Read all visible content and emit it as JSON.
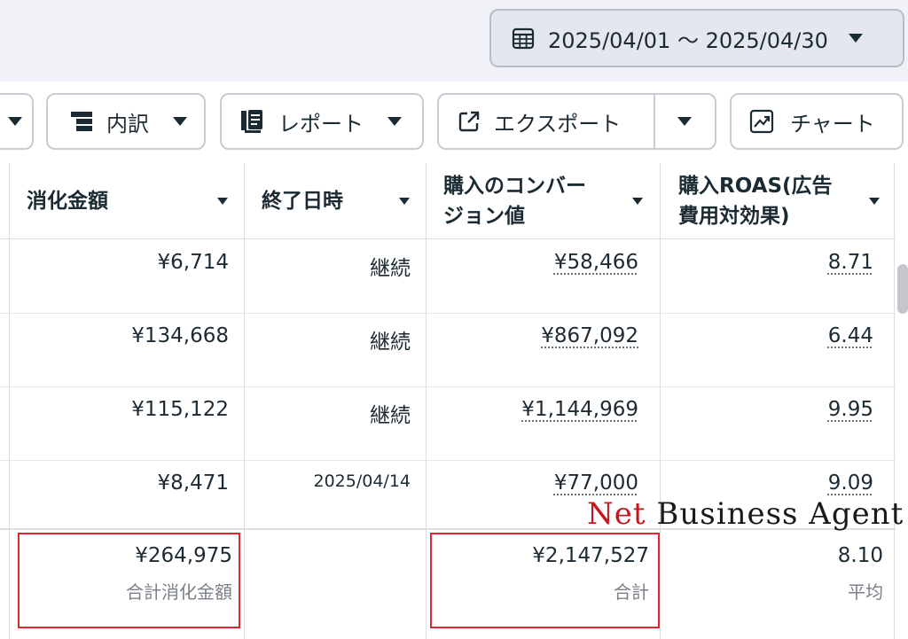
{
  "date_range": {
    "label": "2025/04/01 〜 2025/04/30",
    "icon": "calendar-icon"
  },
  "toolbar": {
    "breakdown_label": "内訳",
    "report_label": "レポート",
    "export_label": "エクスポート",
    "chart_label": "チャート"
  },
  "columns": {
    "spend": "消化金額",
    "end_date": "終了日時",
    "purchase_value_line1": "購入のコンバー",
    "purchase_value_line2": "ジョン値",
    "roas_line1": "購入ROAS(広告",
    "roas_line2": "費用対効果)"
  },
  "rows": [
    {
      "spend": "¥6,714",
      "end": "継続",
      "value": "¥58,466",
      "roas": "8.71"
    },
    {
      "spend": "¥134,668",
      "end": "継続",
      "value": "¥867,092",
      "roas": "6.44"
    },
    {
      "spend": "¥115,122",
      "end": "継続",
      "value": "¥1,144,969",
      "roas": "9.95"
    },
    {
      "spend": "¥8,471",
      "end": "2025/04/14",
      "value": "¥77,000",
      "roas": "9.09"
    }
  ],
  "totals": {
    "spend": "¥264,975",
    "spend_label": "合計消化金額",
    "value": "¥2,147,527",
    "value_label": "合計",
    "roas": "8.10",
    "roas_label": "平均"
  },
  "watermark": {
    "part1": "Net",
    "part2": "Business Agent"
  },
  "colors": {
    "highlight": "#e0262d",
    "watermark_red": "#c4161c"
  }
}
